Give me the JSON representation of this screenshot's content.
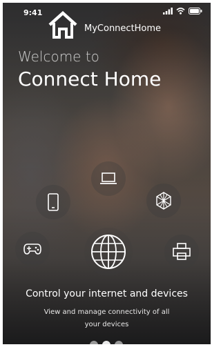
{
  "status_bar": {
    "time": "9:41",
    "icons": [
      "signal-icon",
      "wifi-icon",
      "battery-icon"
    ]
  },
  "brand": {
    "name": "MyConnectHome",
    "logo_icon": "home-icon"
  },
  "welcome": {
    "line1": "Welcome to",
    "line2": "Connect Home"
  },
  "device_icons": [
    {
      "name": "smartphone-icon"
    },
    {
      "name": "laptop-icon"
    },
    {
      "name": "network-icon"
    },
    {
      "name": "game-controller-icon"
    },
    {
      "name": "globe-icon"
    },
    {
      "name": "printer-icon"
    }
  ],
  "onboarding": {
    "title": "Control your internet and devices",
    "subtitle": "View and manage connectivity of all your devices",
    "page_count": 3,
    "active_page": 1
  },
  "colors": {
    "text": "#ffffff",
    "icon_circle": "rgba(60,60,60,0.35)"
  }
}
